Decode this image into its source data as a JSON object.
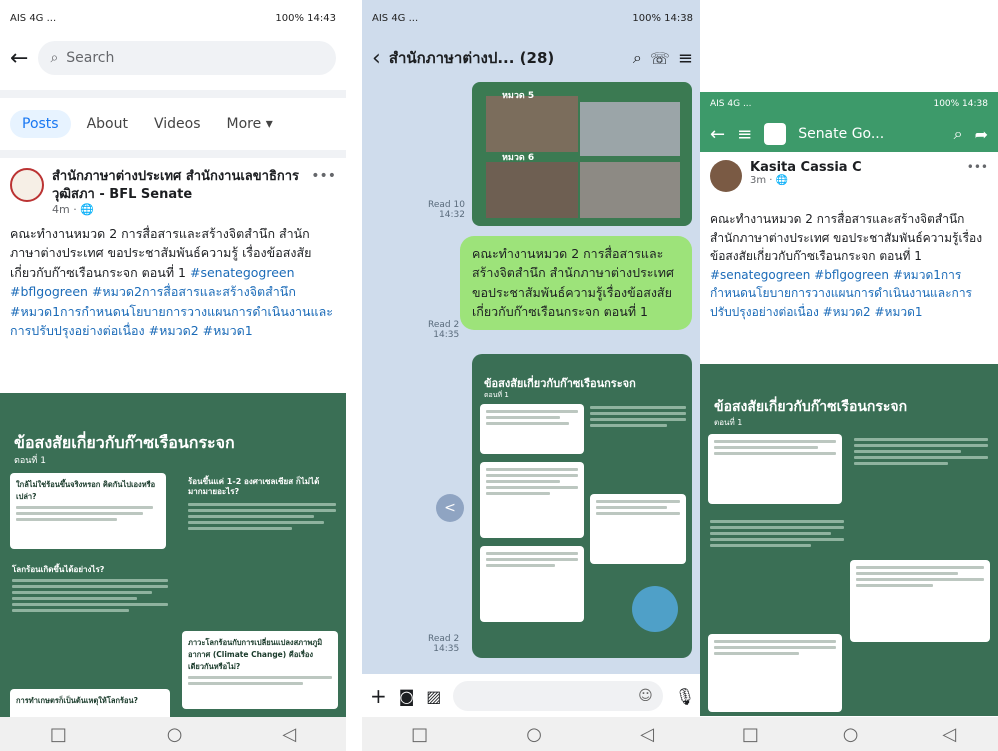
{
  "p1": {
    "status_left": "AIS 4G ...",
    "status_right": "100% 14:43",
    "search_placeholder": "Search",
    "tabs": [
      "Posts",
      "About",
      "Videos",
      "More ▾"
    ],
    "page_name": "สำนักภาษาต่างประเทศ สำนักงานเลขาธิการวุฒิสภา - BFL Senate",
    "post_time": "4m · 🌐",
    "post_text": "คณะทำงานหมวด 2 การสื่อสารและสร้างจิตสำนึก สำนักภาษาต่างประเทศ ขอประชาสัมพันธ์ความรู้ เรื่องข้อสงสัยเกี่ยวกับก๊าซเรือนกระจก ตอนที่ 1",
    "post_tags": "#senategogreen #bflgogreen #หมวด2การสื่อสารและสร้างจิตสำนึก #หมวด1การกำหนดนโยบายการวางแผนการดำเนินงานและการปรับปรุงอย่างต่อเนื่อง #หมวด2 #หมวด1",
    "poster_title": "ข้อสงสัยเกี่ยวกับก๊าซเรือนกระจก",
    "poster_sub": "ตอนที่ 1",
    "q1": "ใกล้ไม่ใช่ร้อนขึ้นจริงหรอก คิดกันไปเองหรือเปล่า?",
    "q2": "ร้อนขึ้นแค่ 1-2 องศาเซลเซียส ก็ไม่ได้มากมายอะไร?",
    "q3": "โลกร้อนเกิดขึ้นได้อย่างไร?",
    "q4": "ภาวะโลกร้อนกับการเปลี่ยนแปลงสภาพภูมิอากาศ (Climate Change) คือเรื่องเดียวกันหรือไม่?",
    "q5": "การทำเกษตรก็เป็นต้นเหตุให้โลกร้อน?"
  },
  "p2": {
    "status_left": "AIS 4G ...",
    "status_right": "100% 14:38",
    "chat_title": "สำนักภาษาต่างป... (28)",
    "read1": "Read 10",
    "time1": "14:32",
    "read2": "Read 2",
    "time2": "14:35",
    "read3": "Read 2",
    "time3": "14:35",
    "img_label1": "หมวด 5",
    "img_label2": "หมวด 6",
    "message": "คณะทำงานหมวด 2 การสื่อสารและสร้างจิตสำนึก สำนักภาษาต่างประเทศ ขอประชาสัมพันธ์ความรู้เรื่องข้อสงสัยเกี่ยวกับก๊าซเรือนกระจก ตอนที่ 1",
    "poster_title": "ข้อสงสัยเกี่ยวกับก๊าซเรือนกระจก",
    "poster_sub": "ตอนที่ 1"
  },
  "p3": {
    "status_left": "AIS 4G ...",
    "status_right": "100% 14:38",
    "group_name": "Senate Go...",
    "author": "Kasita Cassia C",
    "post_time": "3m · 🌐",
    "post_text": "คณะทำงานหมวด 2 การสื่อสารและสร้างจิตสำนึก สำนักภาษาต่างประเทศ ขอประชาสัมพันธ์ความรู้เรื่องข้อสงสัยเกี่ยวกับก๊าซเรือนกระจก ตอนที่ 1",
    "post_tags": "#senategogreen #bflgogreen #หมวด1การกำหนดนโยบายการวางแผนการดำเนินงานและการปรับปรุงอย่างต่อเนื่อง #หมวด2 #หมวด1",
    "poster_title": "ข้อสงสัยเกี่ยวกับก๊าซเรือนกระจก",
    "poster_sub": "ตอนที่ 1"
  }
}
